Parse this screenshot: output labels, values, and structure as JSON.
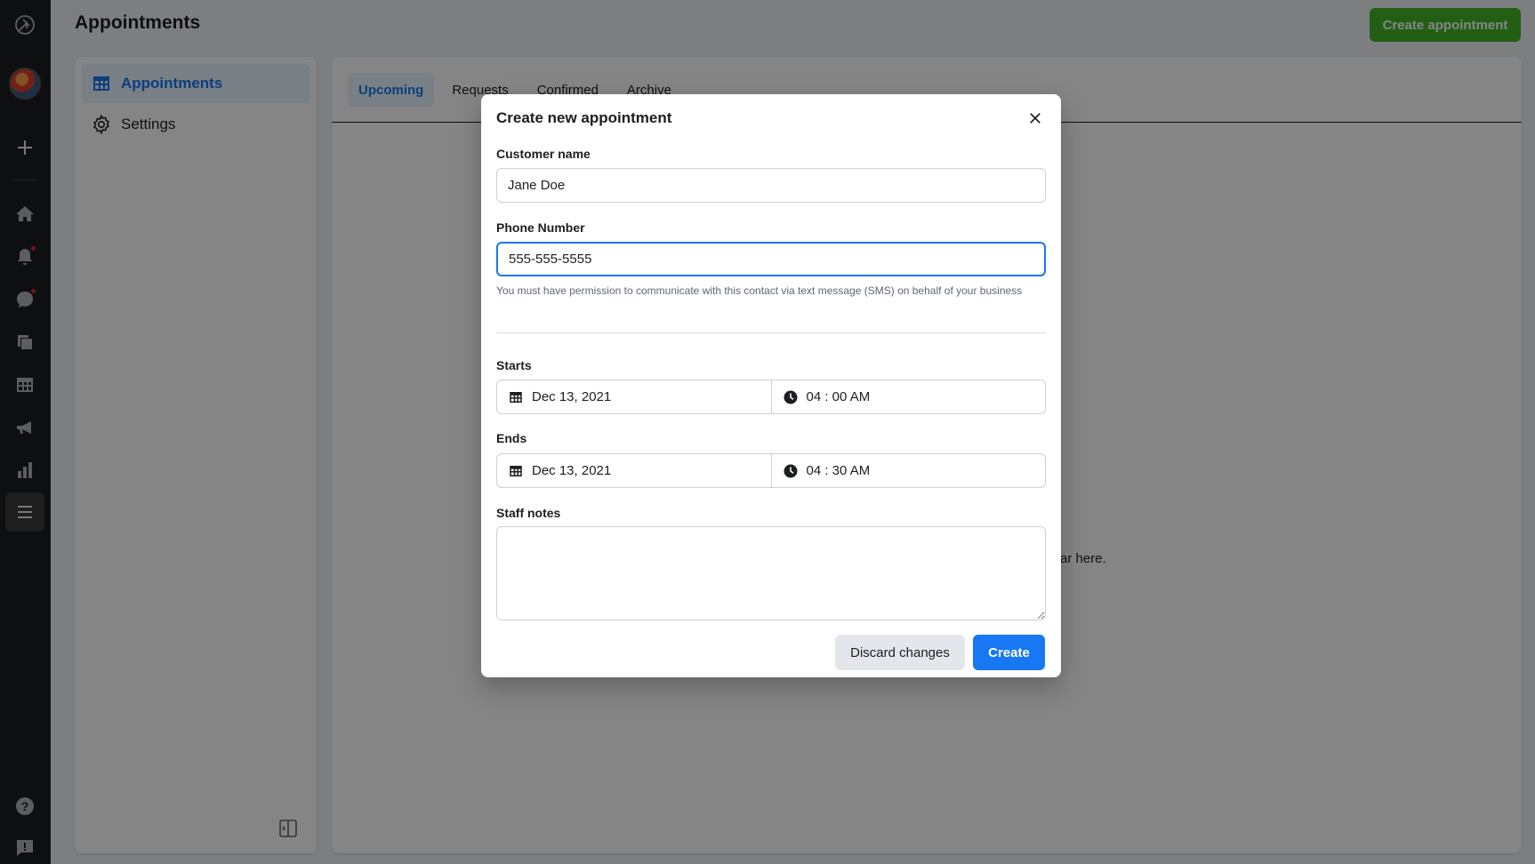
{
  "header": {
    "title": "Appointments",
    "create_button": "Create appointment"
  },
  "rail": {
    "icons": [
      "logo-icon",
      "avatar",
      "plus-icon",
      "home-icon",
      "bell-icon",
      "chat-icon",
      "pages-icon",
      "table-icon",
      "megaphone-icon",
      "bar-chart-icon",
      "menu-icon",
      "help-icon",
      "feedback-icon"
    ]
  },
  "sidenav": {
    "items": [
      {
        "label": "Appointments",
        "icon": "table-icon",
        "active": true
      },
      {
        "label": "Settings",
        "icon": "gear-icon",
        "active": false
      }
    ]
  },
  "main": {
    "tabs": [
      {
        "label": "Upcoming",
        "active": true
      },
      {
        "label": "Requests",
        "active": false
      },
      {
        "label": "Confirmed",
        "active": false
      },
      {
        "label": "Archive",
        "active": false
      }
    ],
    "empty_text": "ar here."
  },
  "modal": {
    "title": "Create new appointment",
    "customer_name": {
      "label": "Customer name",
      "value": "Jane Doe"
    },
    "phone": {
      "label": "Phone Number",
      "value": "555-555-5555",
      "helper": "You must have permission to communicate with this contact via text message (SMS) on behalf of your business"
    },
    "starts": {
      "label": "Starts",
      "date": "Dec 13, 2021",
      "time": "04 : 00 AM"
    },
    "ends": {
      "label": "Ends",
      "date": "Dec 13, 2021",
      "time": "04 : 30 AM"
    },
    "staff_notes": {
      "label": "Staff notes",
      "value": ""
    },
    "discard_label": "Discard changes",
    "create_label": "Create"
  },
  "colors": {
    "accent": "#1877f2",
    "create_green": "#42b72a",
    "rail_bg": "#1c1e21"
  }
}
